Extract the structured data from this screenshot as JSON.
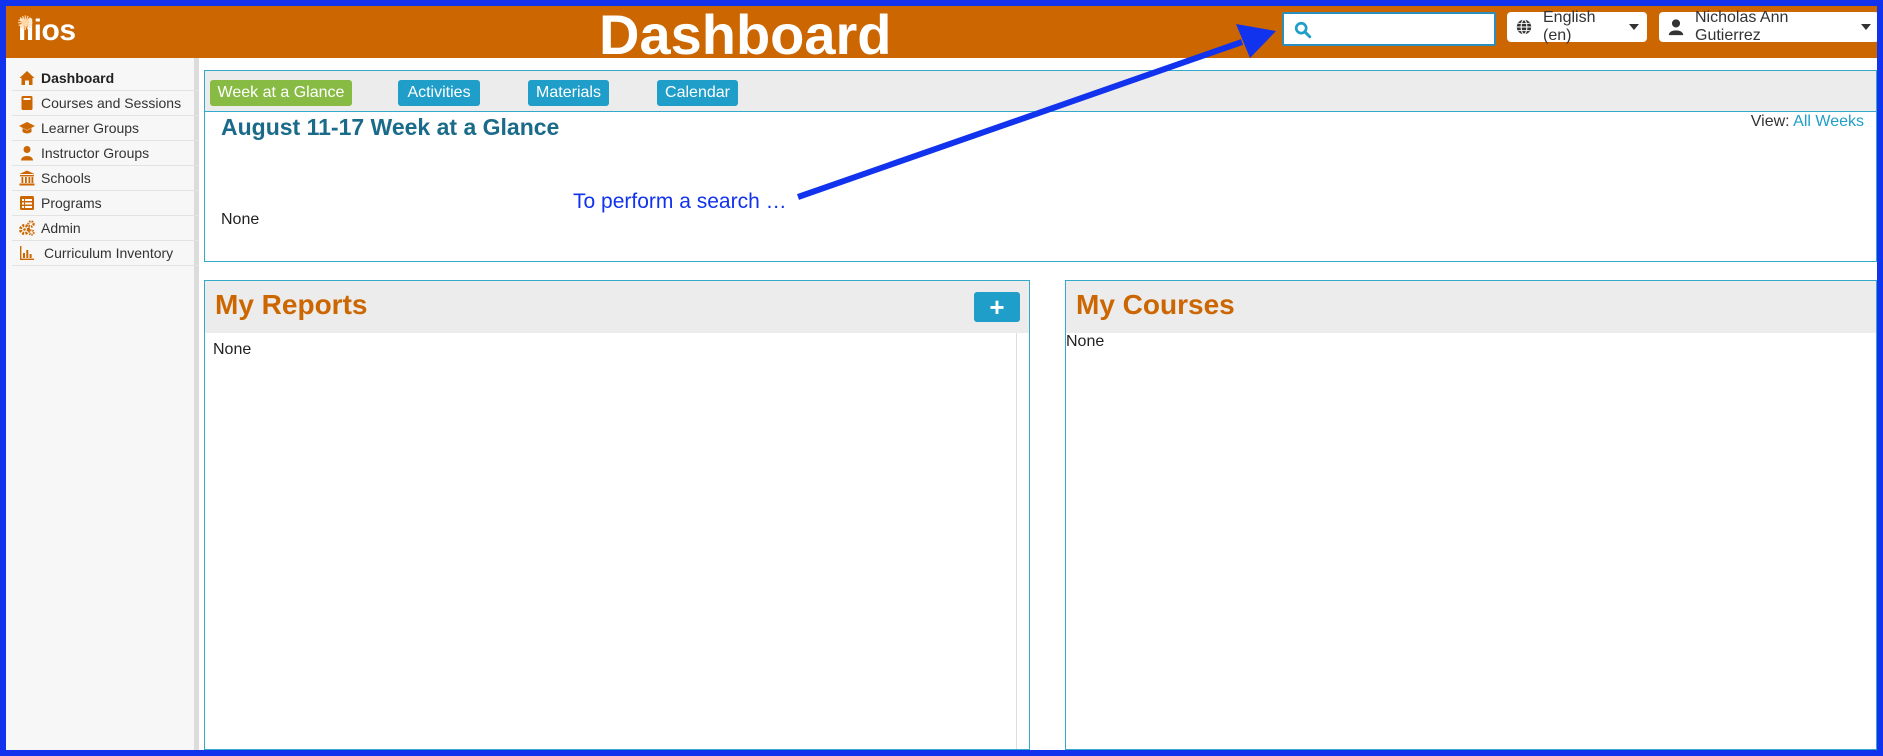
{
  "header": {
    "logo": "ilios",
    "title": "Dashboard",
    "search": {
      "value": "",
      "placeholder": ""
    },
    "language": "English (en)",
    "user": "Nicholas Ann Gutierrez"
  },
  "sidebar": {
    "items": [
      {
        "label": "Dashboard",
        "icon": "home-icon",
        "active": true
      },
      {
        "label": "Courses and Sessions",
        "icon": "book-icon"
      },
      {
        "label": "Learner Groups",
        "icon": "graduation-cap-icon"
      },
      {
        "label": "Instructor Groups",
        "icon": "user-icon"
      },
      {
        "label": "Schools",
        "icon": "institution-icon"
      },
      {
        "label": "Programs",
        "icon": "list-icon"
      },
      {
        "label": "Admin",
        "icon": "cogs-icon"
      },
      {
        "label": "Curriculum Inventory",
        "icon": "bar-chart-icon"
      }
    ]
  },
  "dashboard": {
    "tabs": {
      "week": "Week at a Glance",
      "activities": "Activities",
      "materials": "Materials",
      "calendar": "Calendar"
    },
    "glance": {
      "title": "August 11-17 Week at a Glance",
      "view_label": "View:",
      "view_link": "All Weeks",
      "empty": "None"
    },
    "reports": {
      "title": "My Reports",
      "add": "+",
      "empty": "None"
    },
    "courses": {
      "title": "My Courses",
      "empty": "None"
    }
  },
  "annotation": {
    "text": "To perform a search …",
    "color": "#1133ee"
  },
  "colors": {
    "header": "#cc6600",
    "accent": "#1e9ec9",
    "active_tab": "#88bb44",
    "panel_title": "#cc6600",
    "glance_title": "#1a6a8a"
  }
}
